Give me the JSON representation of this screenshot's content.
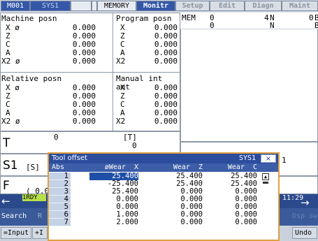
{
  "topbar": {
    "program": "M001",
    "system": "SYS1",
    "mode": "MEMORY",
    "tabs": [
      "Monitr",
      "Setup",
      "Edit",
      "Diagn",
      "Maint"
    ]
  },
  "status": {
    "mode": "MEM",
    "r1": [
      "0",
      "4",
      "N",
      "0",
      "B"
    ],
    "r2": [
      "0",
      "N",
      "B"
    ]
  },
  "machine": {
    "title": "Machine posn",
    "axes": [
      "X ø",
      "Z",
      "C",
      "A",
      "X2 ø"
    ],
    "values": [
      "0.000",
      "0.000",
      "0.000",
      "0.000",
      "0.000"
    ]
  },
  "program": {
    "title": "Program posn",
    "axes": [
      "X",
      "Z",
      "C",
      "A",
      "X2"
    ],
    "values": [
      "0.000",
      "0.000",
      "0.000",
      "0.000",
      "0.000"
    ]
  },
  "relative": {
    "title": "Relative posn",
    "axes": [
      "X ø",
      "Z",
      "C",
      "A",
      "X2 ø"
    ],
    "values": [
      "0.000",
      "0.000",
      "0.000",
      "0.000",
      "0.000"
    ]
  },
  "manual": {
    "title": "Manual int amt",
    "axes": [
      "X",
      "Z",
      "C",
      "A",
      "X2"
    ],
    "values": [
      "0.000",
      "0.000",
      "0.000",
      "0.000",
      "0.000"
    ]
  },
  "t": {
    "label": "T",
    "value": "0",
    "bracket": "[T]",
    "bval": "0"
  },
  "s1": {
    "label": "S1",
    "unit": "[S]",
    "right": "1"
  },
  "f": {
    "label": "F",
    "partial": "( 0.0"
  },
  "rdy": "1RDY",
  "clock": "11:29",
  "popup": {
    "title": "Tool offset",
    "sys": "SYS1",
    "close": "×",
    "headers": [
      "Abs",
      "øWear  X",
      "Wear  Z",
      "Wear  C"
    ],
    "rows": [
      [
        "1",
        "25.400",
        "25.400",
        "25.400"
      ],
      [
        "2",
        "-25.400",
        "25.400",
        "25.400"
      ],
      [
        "3",
        "25.400",
        "0.000",
        "0.000"
      ],
      [
        "4",
        "0.000",
        "0.000",
        "0.000"
      ],
      [
        "5",
        "0.000",
        "0.000",
        "0.000"
      ],
      [
        "6",
        "1.000",
        "0.000",
        "0.000"
      ],
      [
        "7",
        "2.000",
        "0.000",
        "0.000"
      ]
    ]
  },
  "bottom": {
    "search": "Search",
    "search_tail": "R",
    "input": "=Input",
    "input2": "+I",
    "dsp": "Dsp sw",
    "undo": "Undo"
  }
}
